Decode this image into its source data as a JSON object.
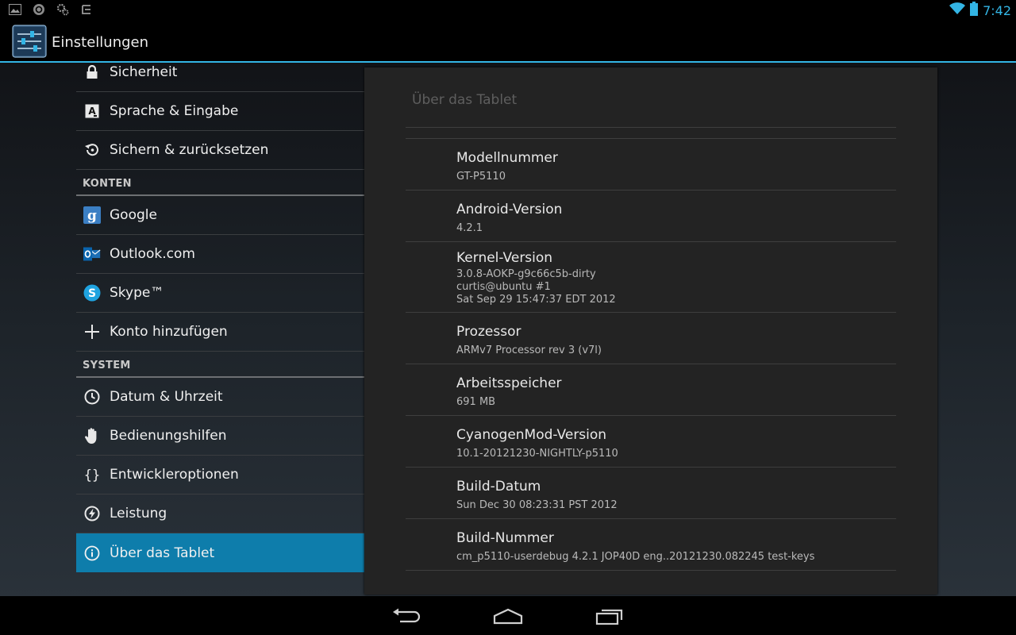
{
  "status_bar": {
    "time": "7:42",
    "icons_left": [
      "gallery-icon",
      "sync-icon",
      "settings-notify-icon",
      "keyboard-icon"
    ],
    "icons_right": [
      "wifi-icon",
      "battery-icon"
    ],
    "accent": "#33b5e5"
  },
  "action_bar": {
    "title": "Einstellungen",
    "icon": "settings-sliders-icon"
  },
  "sidebar": {
    "items_top": [
      {
        "label": "Sicherheit",
        "icon": "lock-icon"
      },
      {
        "label": "Sprache & Eingabe",
        "icon": "language-icon"
      },
      {
        "label": "Sichern & zurücksetzen",
        "icon": "backup-icon"
      }
    ],
    "header_accounts": "KONTEN",
    "items_accounts": [
      {
        "label": "Google",
        "icon": "google-icon"
      },
      {
        "label": "Outlook.com",
        "icon": "outlook-icon"
      },
      {
        "label": "Skype™",
        "icon": "skype-icon"
      },
      {
        "label": "Konto hinzufügen",
        "icon": "add-icon"
      }
    ],
    "header_system": "SYSTEM",
    "items_system": [
      {
        "label": "Datum & Uhrzeit",
        "icon": "clock-icon"
      },
      {
        "label": "Bedienungshilfen",
        "icon": "accessibility-hand-icon"
      },
      {
        "label": "Entwickleroptionen",
        "icon": "braces-icon"
      },
      {
        "label": "Leistung",
        "icon": "performance-icon"
      },
      {
        "label": "Über das Tablet",
        "icon": "info-icon",
        "selected": true
      }
    ],
    "selected_color": "#0e7dab"
  },
  "detail": {
    "title": "Über das Tablet",
    "items": [
      {
        "title": "Modellnummer",
        "value": "GT-P5110"
      },
      {
        "title": "Android-Version",
        "value": "4.2.1"
      },
      {
        "title": "Kernel-Version",
        "value": "3.0.8-AOKP-g9c66c5b-dirty\ncurtis@ubuntu #1\nSat Sep 29 15:47:37 EDT 2012"
      },
      {
        "title": "Prozessor",
        "value": "ARMv7 Processor rev 3 (v7l)"
      },
      {
        "title": "Arbeitsspeicher",
        "value": "691 MB"
      },
      {
        "title": "CyanogenMod-Version",
        "value": "10.1-20121230-NIGHTLY-p5110"
      },
      {
        "title": "Build-Datum",
        "value": "Sun Dec 30 08:23:31 PST 2012"
      },
      {
        "title": "Build-Nummer",
        "value": "cm_p5110-userdebug 4.2.1 JOP40D eng..20121230.082245 test-keys"
      }
    ]
  },
  "nav_bar": {
    "buttons": [
      "back-icon",
      "home-icon",
      "recents-icon"
    ]
  }
}
